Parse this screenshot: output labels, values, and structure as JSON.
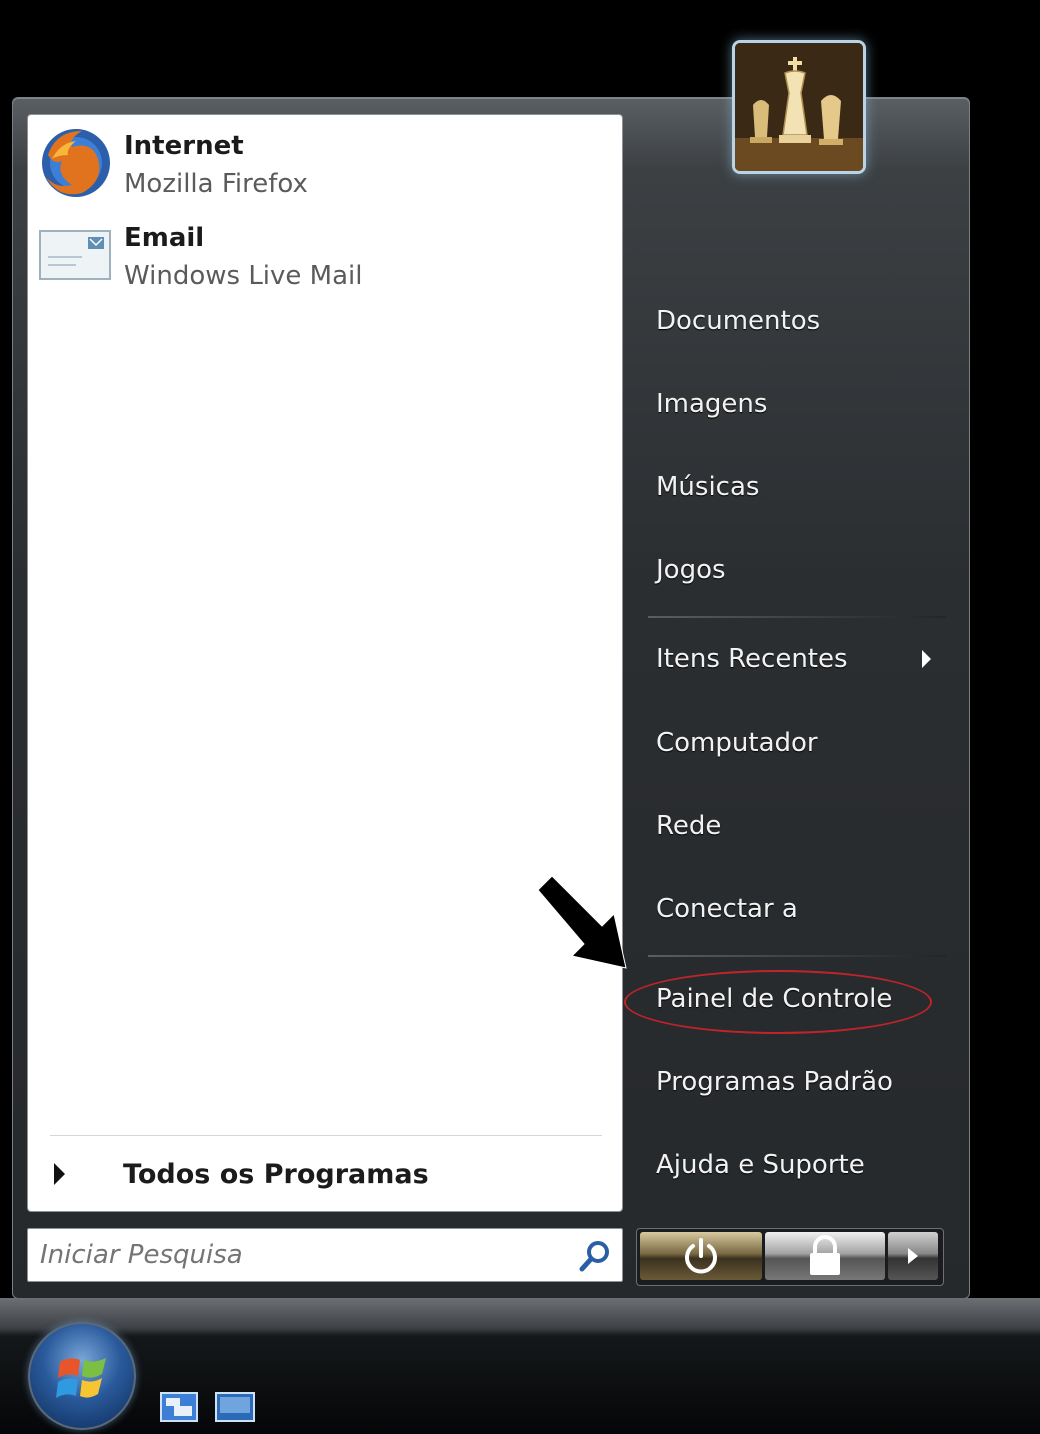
{
  "pinned": [
    {
      "title": "Internet",
      "subtitle": "Mozilla Firefox",
      "icon": "firefox-icon"
    },
    {
      "title": "Email",
      "subtitle": "Windows Live Mail",
      "icon": "mail-icon"
    }
  ],
  "all_programs": {
    "label": "Todos os Programas"
  },
  "search": {
    "placeholder": "Iniciar Pesquisa"
  },
  "right": {
    "items": [
      "Documentos",
      "Imagens",
      "Músicas",
      "Jogos",
      "Itens Recentes",
      "Computador",
      "Rede",
      "Conectar a",
      "Painel de Controle",
      "Programas Padrão",
      "Ajuda e Suporte"
    ]
  },
  "colors": {
    "highlight": "#c0242a",
    "menu_text": "#f2f2f2"
  }
}
